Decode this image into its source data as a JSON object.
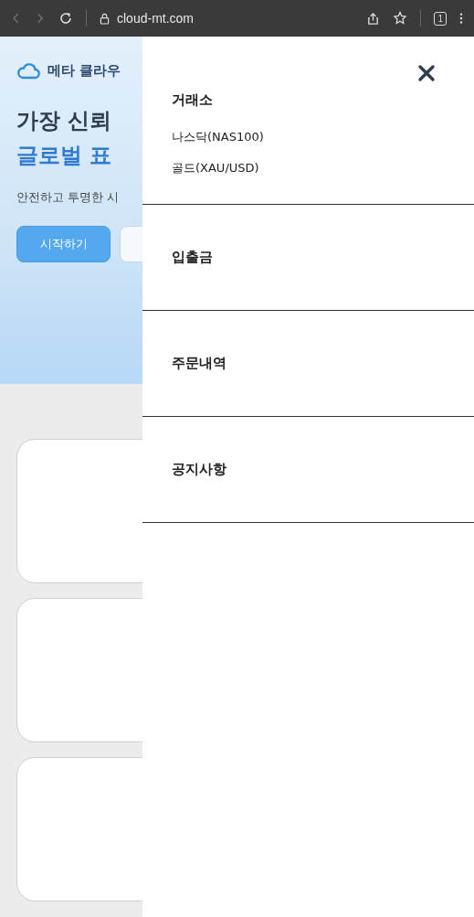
{
  "browser": {
    "url": "cloud-mt.com",
    "tab_count": "1"
  },
  "hero": {
    "brand": "메타 클라우",
    "headline_lines": [
      {
        "text": "가장 신뢰",
        "accent": false
      },
      {
        "text": "글로벌 표",
        "accent": true
      }
    ],
    "subtitle": "안전하고 투명한 시",
    "buttons": [
      {
        "label": "시작하기",
        "kind": "primary"
      },
      {
        "kind": "outline"
      }
    ]
  },
  "cards": [
    {
      "kind": "blank"
    },
    {
      "kind": "blank"
    },
    {
      "kind": "blank"
    }
  ],
  "menu": {
    "sections": [
      {
        "title": "거래소",
        "items": [
          "나스닥(NAS100)",
          "골드(XAU/USD)"
        ]
      },
      {
        "title": "입출금"
      },
      {
        "title": "주문내역"
      },
      {
        "title": "공지사항"
      }
    ]
  }
}
